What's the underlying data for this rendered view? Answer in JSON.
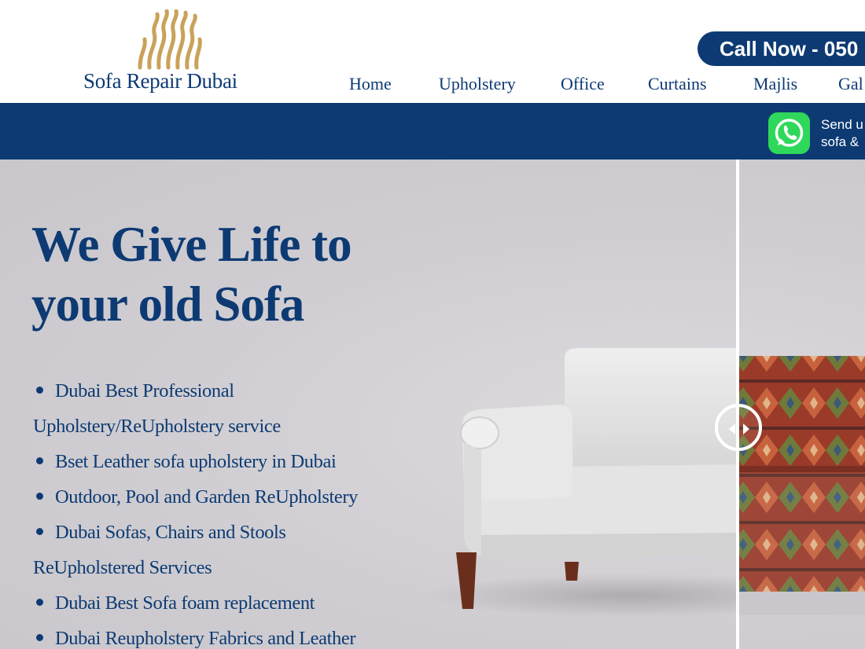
{
  "brand": {
    "name": "Sofa Repair Dubai",
    "color": "#0d3a73",
    "gold": "#c9a25a"
  },
  "header": {
    "call_button": "Call Now - 050",
    "nav": [
      {
        "label": "Home"
      },
      {
        "label": "Upholstery"
      },
      {
        "label": "Office"
      },
      {
        "label": "Curtains"
      },
      {
        "label": "Majlis"
      },
      {
        "label": "Gal"
      }
    ]
  },
  "bluebar": {
    "whatsapp_icon": "whatsapp-icon",
    "whatsapp_line1": "Send u",
    "whatsapp_line2": "sofa &"
  },
  "hero": {
    "headline_line1": "We Give Life to",
    "headline_line2": "your old Sofa",
    "features": [
      "Dubai Best Professional",
      "Upholstery/ReUpholstery service",
      "Bset Leather sofa upholstery in Dubai",
      "Outdoor, Pool and Garden ReUpholstery",
      "Dubai Sofas, Chairs and Stools",
      "ReUpholstered Services",
      "Dubai Best Sofa foam replacement",
      "Dubai Reupholstery Fabrics and Leather"
    ],
    "compare_handle_icon": "left-right-arrows-icon"
  }
}
